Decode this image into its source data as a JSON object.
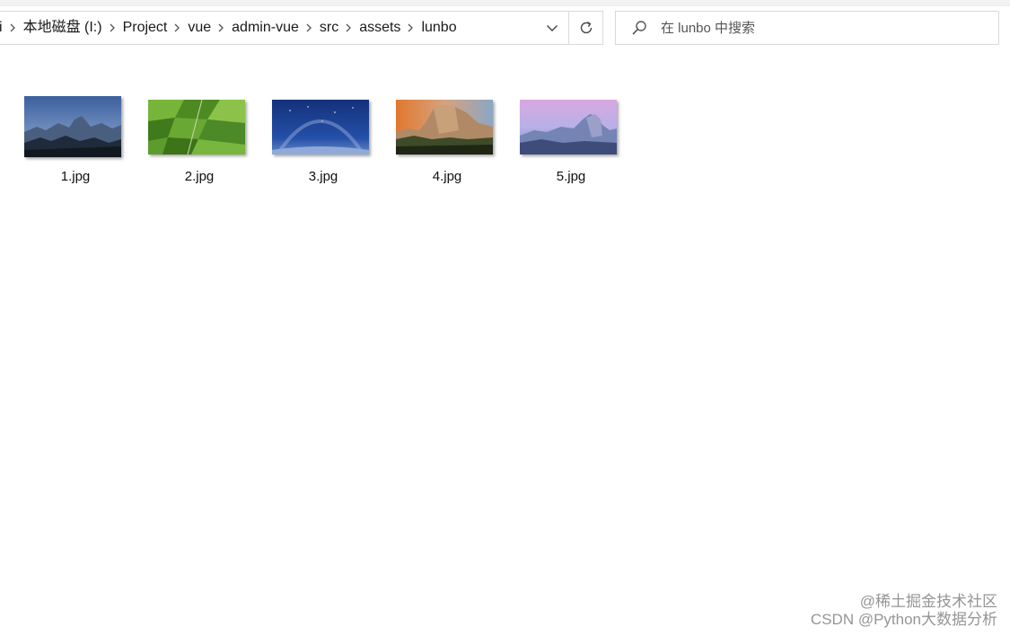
{
  "address_bar": {
    "crumbs": [
      "i",
      "本地磁盘 (I:)",
      "Project",
      "vue",
      "admin-vue",
      "src",
      "assets",
      "lunbo"
    ]
  },
  "search": {
    "placeholder": "在 lunbo 中搜索"
  },
  "files": [
    {
      "name": "1.jpg"
    },
    {
      "name": "2.jpg"
    },
    {
      "name": "3.jpg"
    },
    {
      "name": "4.jpg"
    },
    {
      "name": "5.jpg"
    }
  ],
  "watermark": {
    "line1": "@稀土掘金技术社区",
    "line2": "CSDN @Python大数据分析"
  }
}
